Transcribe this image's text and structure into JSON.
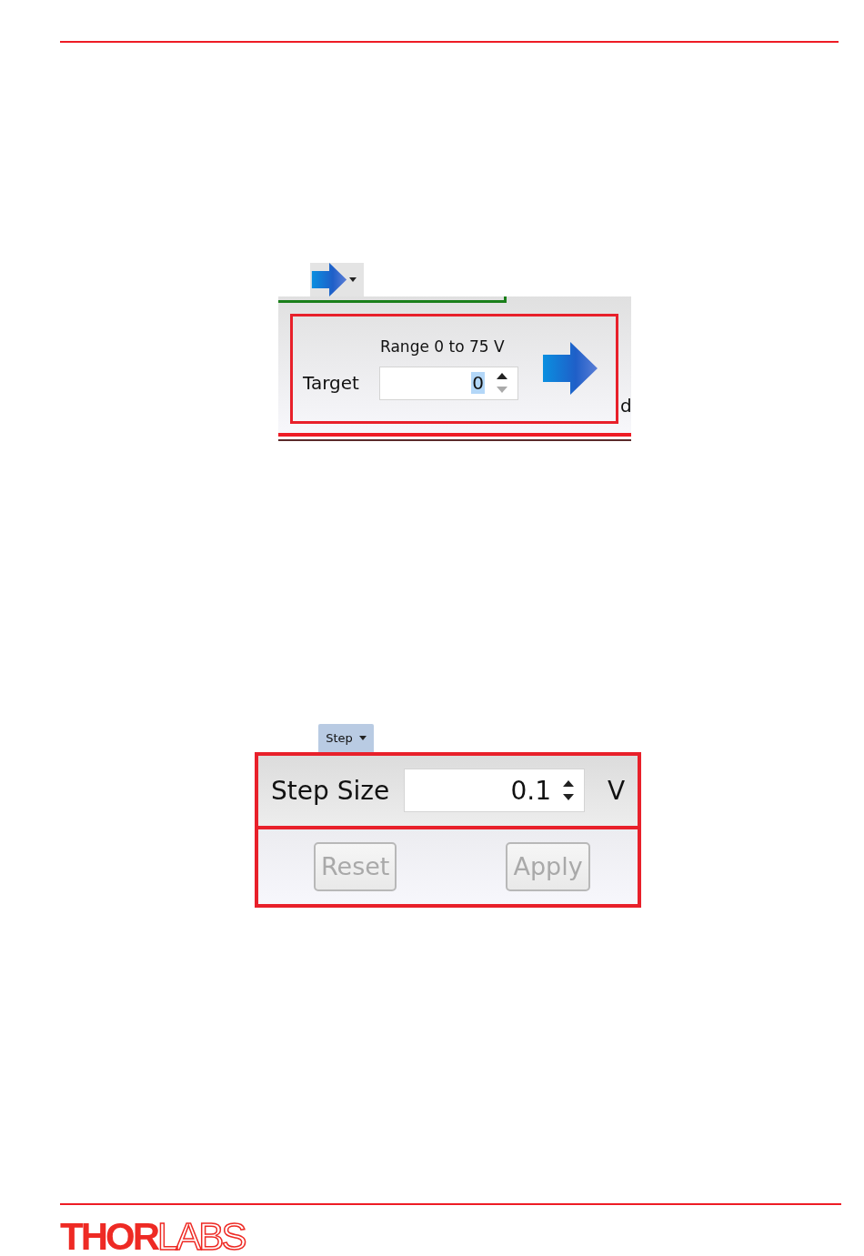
{
  "set_panel": {
    "range_label": "Range 0 to 75 V",
    "target_label": "Target",
    "target_value": "0",
    "value_selected": true,
    "cut_text": "d"
  },
  "step_panel": {
    "menu_button": "Step",
    "step_size_label": "Step Size",
    "step_value": "0.1",
    "unit": "V",
    "buttons": [
      {
        "label": "Reset",
        "disabled": true
      },
      {
        "label": "Apply",
        "disabled": true
      }
    ]
  },
  "footer": {
    "logo": [
      "THOR",
      "LABS"
    ]
  }
}
